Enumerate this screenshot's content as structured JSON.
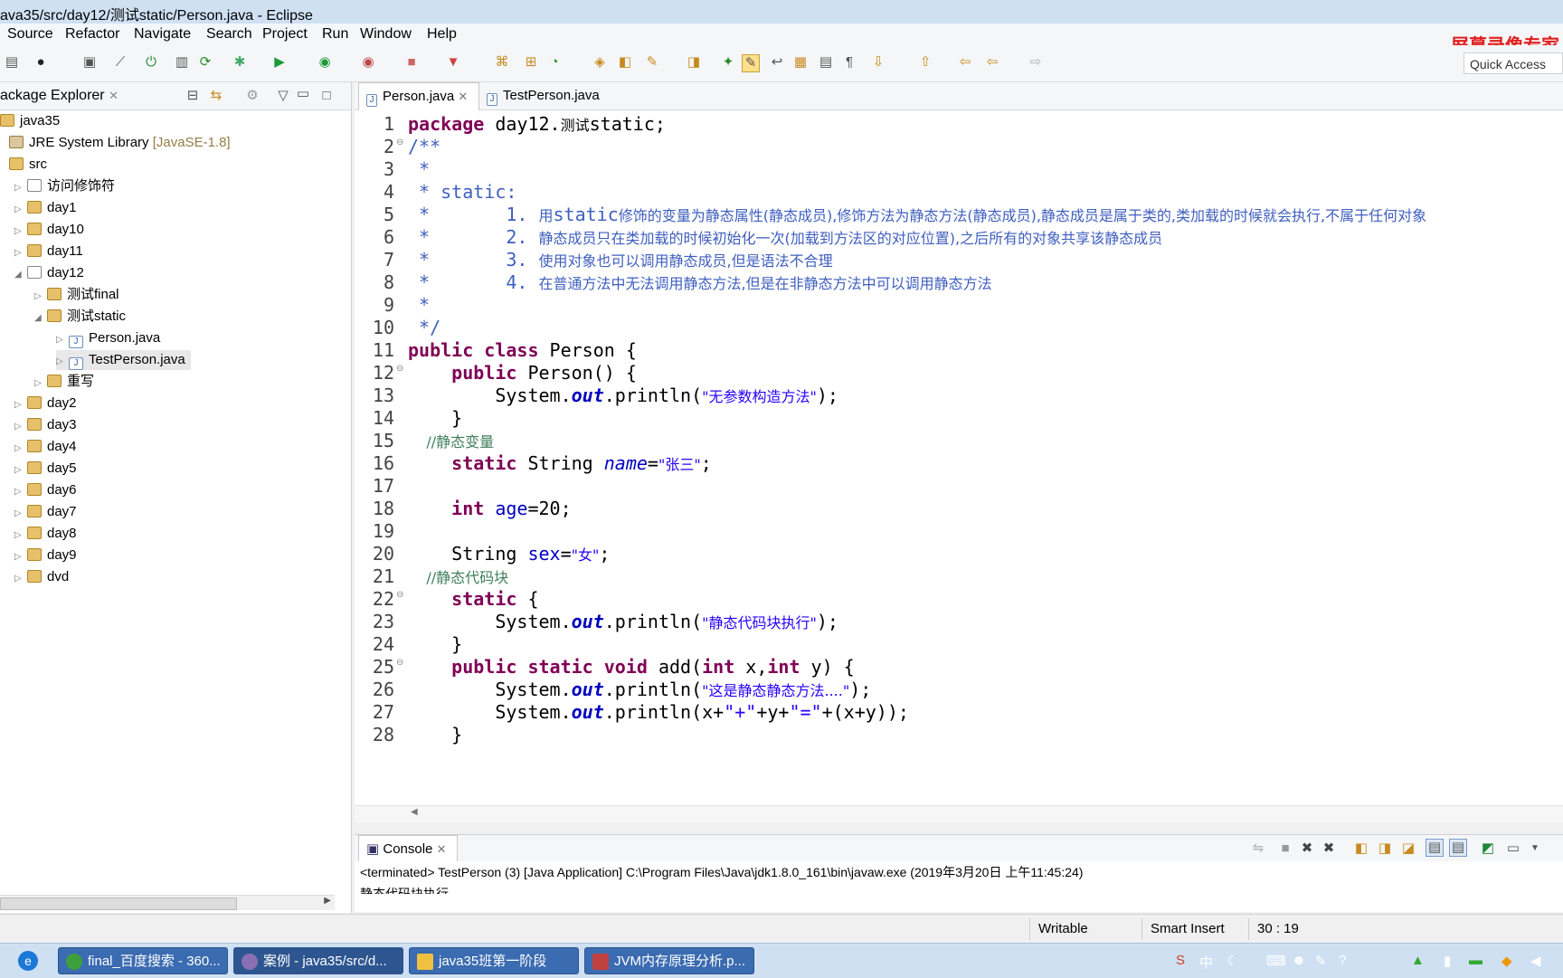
{
  "window": {
    "title": "ava35/src/day12/测试static/Person.java - Eclipse"
  },
  "menu": [
    "Source",
    "Refactor",
    "Navigate",
    "Search",
    "Project",
    "Run",
    "Window",
    "Help"
  ],
  "watermark": "屏幕录像专家",
  "quick_access": "Quick Access",
  "package_explorer": {
    "title": "ackage Explorer",
    "items": [
      {
        "label": "java35",
        "suffix": ""
      },
      {
        "label": "JRE System Library",
        "suffix": "[JavaSE-1.8]"
      },
      {
        "label": "src",
        "suffix": ""
      },
      {
        "label": "访问修饰符",
        "suffix": ""
      },
      {
        "label": "day1",
        "suffix": ""
      },
      {
        "label": "day10",
        "suffix": ""
      },
      {
        "label": "day11",
        "suffix": ""
      },
      {
        "label": "day12",
        "suffix": ""
      },
      {
        "label": "测试final",
        "suffix": ""
      },
      {
        "label": "测试static",
        "suffix": ""
      },
      {
        "label": "Person.java",
        "suffix": ""
      },
      {
        "label": "TestPerson.java",
        "suffix": ""
      },
      {
        "label": "重写",
        "suffix": ""
      },
      {
        "label": "day2",
        "suffix": ""
      },
      {
        "label": "day3",
        "suffix": ""
      },
      {
        "label": "day4",
        "suffix": ""
      },
      {
        "label": "day5",
        "suffix": ""
      },
      {
        "label": "day6",
        "suffix": ""
      },
      {
        "label": "day7",
        "suffix": ""
      },
      {
        "label": "day8",
        "suffix": ""
      },
      {
        "label": "day9",
        "suffix": ""
      },
      {
        "label": "dvd",
        "suffix": ""
      }
    ]
  },
  "editor": {
    "tabs": [
      "Person.java",
      "TestPerson.java"
    ],
    "lines": [
      "1",
      "2",
      "3",
      "4",
      "5",
      "6",
      "7",
      "8",
      "9",
      "10",
      "11",
      "12",
      "13",
      "14",
      "15",
      "16",
      "17",
      "18",
      "19",
      "20",
      "21",
      "22",
      "23",
      "24",
      "25",
      "26",
      "27",
      "28"
    ],
    "code": {
      "l1_kw": "package",
      "l1_rest": " day12.",
      "l1_cn": "测试",
      "l1_end": "static;",
      "l2": "/**",
      "l3": " *",
      "l4": " * static:",
      "l5_num": " *       1. ",
      "l5_a": "用",
      "l5_b": "static",
      "l5_c": "修饰的变量为静态属性(静态成员),修饰方法为静态方法(静态成员),静态成员是属于类的,类加载的时候就会执行,不属于任何对象",
      "l6_num": " *       2. ",
      "l6_c": "静态成员只在类加载的时候初始化一次(加载到方法区的对应位置),之后所有的对象共享该静态成员",
      "l7_num": " *       3. ",
      "l7_c": "使用对象也可以调用静态成员,但是语法不合理",
      "l8_num": " *       4. ",
      "l8_c": "在普通方法中无法调用静态方法,但是在非静态方法中可以调用静态方法",
      "l9": " *",
      "l10": " */",
      "l11_kw": "public class",
      "l11_rest": " Person {",
      "l12_kw": "    public",
      "l12_rest": " Person() {",
      "l13_a": "        System.",
      "l13_out": "out",
      "l13_b": ".println(",
      "l13_str": "\"无参数构造方法\"",
      "l13_c": ");",
      "l14": "    }",
      "l15": "    //静态变量",
      "l16_kw": "    static",
      "l16_a": " String ",
      "l16_f": "name",
      "l16_b": "=",
      "l16_str": "\"张三\"",
      "l16_c": ";",
      "l18_kw": "    int",
      "l18_a": " ",
      "l18_f": "age",
      "l18_b": "=20;",
      "l20_a": "    String ",
      "l20_f": "sex",
      "l20_b": "=",
      "l20_str": "\"女\"",
      "l20_c": ";",
      "l21": "    //静态代码块",
      "l22_kw": "    static",
      "l22_rest": " {",
      "l23_a": "        System.",
      "l23_out": "out",
      "l23_b": ".println(",
      "l23_str": "\"静态代码块执行\"",
      "l23_c": ");",
      "l24": "    }",
      "l25_kw1": "    public static void",
      "l25_a": " add(",
      "l25_kw2": "int",
      "l25_b": " x,",
      "l25_kw3": "int",
      "l25_c": " y) {",
      "l26_a": "        System.",
      "l26_out": "out",
      "l26_b": ".println(",
      "l26_str": "\"这是静态静态方法....\"",
      "l26_c": ");",
      "l27_a": "        System.",
      "l27_out": "out",
      "l27_b": ".println(x+",
      "l27_s1": "\"+\"",
      "l27_c": "+y+",
      "l27_s2": "\"=\"",
      "l27_d": "+(x+y));",
      "l28": "    }"
    }
  },
  "console": {
    "title": "Console",
    "terminated": "<terminated> TestPerson (3) [Java Application] C:\\Program Files\\Java\\jdk1.8.0_161\\bin\\javaw.exe (2019年3月20日 上午11:45:24)",
    "output": "静态代码块执行"
  },
  "status": {
    "writable": "Writable",
    "insert": "Smart Insert",
    "position": "30 : 19"
  },
  "taskbar": [
    "final_百度搜索 - 360...",
    "案例 - java35/src/d...",
    "java35班第一阶段",
    "JVM内存原理分析.p..."
  ],
  "colors": {
    "keyword": "#7f0055",
    "comment": "#3f5fbf",
    "string": "#2a00ff",
    "field": "#0000c0"
  }
}
